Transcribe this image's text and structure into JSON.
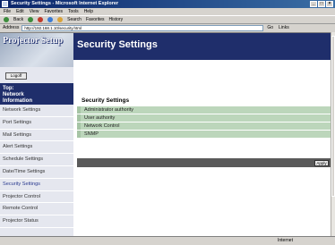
{
  "window": {
    "title": "Security Settings - Microsoft Internet Explorer"
  },
  "menubar": {
    "items": [
      "File",
      "Edit",
      "View",
      "Favorites",
      "Tools",
      "Help"
    ]
  },
  "toolbar": {
    "back": "Back",
    "search": "Search",
    "favorites": "Favorites",
    "history": "History"
  },
  "addressbar": {
    "label": "Address",
    "url": "http://192.168.1.10/security.html",
    "go": "Go",
    "links": "Links"
  },
  "logo": {
    "text": "Projector Setup"
  },
  "header": {
    "title": "Security Settings"
  },
  "sidebar": {
    "logoff": "Logoff",
    "top_label": "Top:",
    "top_sub1": "Network",
    "top_sub2": "Information",
    "items": [
      "Network Settings",
      "Port Settings",
      "Mail Settings",
      "Alert Settings",
      "Schedule Settings",
      "Date/Time Settings",
      "Security Settings",
      "Projector Control",
      "Remote Control",
      "Projector Status"
    ]
  },
  "main": {
    "section_title": "Security Settings",
    "items": [
      "Administrator authority",
      "User authority",
      "Network Control",
      "SNMP"
    ],
    "apply": "Apply"
  },
  "status": {
    "zone": "Internet"
  }
}
